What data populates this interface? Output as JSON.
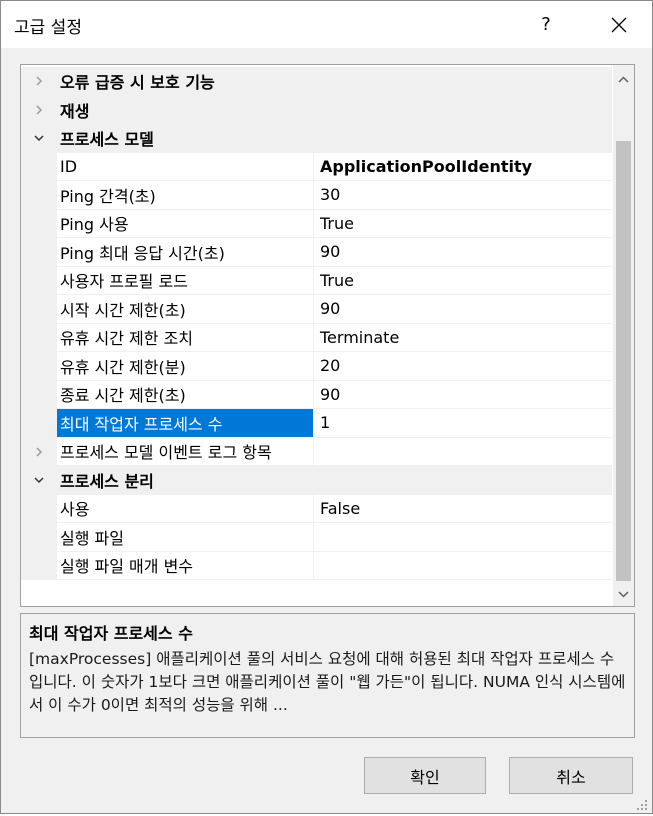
{
  "window": {
    "title": "고급 설정",
    "help_label": "?"
  },
  "grid": {
    "rows": [
      {
        "kind": "category",
        "label": "오류 급증 시 보호 기능",
        "expanded": false
      },
      {
        "kind": "category",
        "label": "재생",
        "expanded": false
      },
      {
        "kind": "category",
        "label": "프로세스 모델",
        "expanded": true
      },
      {
        "kind": "property",
        "name": "ID",
        "value": "ApplicationPoolIdentity",
        "bold": true
      },
      {
        "kind": "property",
        "name": "Ping 간격(초)",
        "value": "30"
      },
      {
        "kind": "property",
        "name": "Ping 사용",
        "value": "True"
      },
      {
        "kind": "property",
        "name": "Ping 최대 응답 시간(초)",
        "value": "90"
      },
      {
        "kind": "property",
        "name": "사용자 프로필 로드",
        "value": "True"
      },
      {
        "kind": "property",
        "name": "시작 시간 제한(초)",
        "value": "90"
      },
      {
        "kind": "property",
        "name": "유휴 시간 제한 조치",
        "value": "Terminate"
      },
      {
        "kind": "property",
        "name": "유휴 시간 제한(분)",
        "value": "20"
      },
      {
        "kind": "property",
        "name": "종료 시간 제한(초)",
        "value": "90"
      },
      {
        "kind": "property",
        "name": "최대 작업자 프로세스 수",
        "value": "1",
        "selected": true
      },
      {
        "kind": "property",
        "name": "프로세스 모델 이벤트 로그 항목",
        "value": "",
        "expandable": true
      },
      {
        "kind": "category",
        "label": "프로세스 분리",
        "expanded": true
      },
      {
        "kind": "property",
        "name": "사용",
        "value": "False"
      },
      {
        "kind": "property",
        "name": "실행 파일",
        "value": ""
      },
      {
        "kind": "property",
        "name": "실행 파일 매개 변수",
        "value": ""
      }
    ]
  },
  "description": {
    "title": "최대 작업자 프로세스 수",
    "text": "[maxProcesses] 애플리케이션 풀의 서비스 요청에 대해 허용된 최대 작업자 프로세스 수입니다. 이 숫자가 1보다 크면 애플리케이션 풀이 \"웹 가든\"이 됩니다. NUMA 인식 시스템에서 이 수가 0이면 최적의 성능을 위해 ..."
  },
  "buttons": {
    "ok_label": "확인",
    "cancel_label": "취소"
  },
  "colors": {
    "selection": "#0078d7",
    "category_bg": "#f0f0f0",
    "dialog_bg": "#f0f0f0"
  }
}
